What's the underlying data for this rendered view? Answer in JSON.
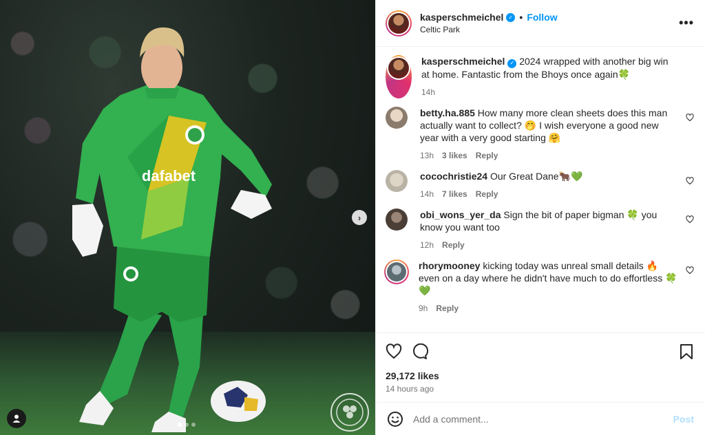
{
  "post": {
    "username": "kasperschmeichel",
    "location": "Celtic Park",
    "follow_label": "Follow",
    "sep": "•",
    "more": "•••"
  },
  "caption": {
    "username": "kasperschmeichel",
    "text": "2024 wrapped with another big win at home. Fantastic from the Bhoys once again🍀",
    "time": "14h"
  },
  "comments": [
    {
      "username": "betty.ha.885",
      "text": "How many more clean sheets does this man actually want to collect? 🤭 I wish everyone a good new year with a very good starting 🤗",
      "time": "13h",
      "likes": "3 likes",
      "reply": "Reply",
      "avatar_color": "#8a7b6d"
    },
    {
      "username": "cocochristie24",
      "text": "Our Great Dane🐂💚",
      "time": "14h",
      "likes": "7 likes",
      "reply": "Reply",
      "avatar_color": "#b9b3a6"
    },
    {
      "username": "obi_wons_yer_da",
      "text": "Sign the bit of paper bigman 🍀 you know you want too",
      "time": "12h",
      "likes": "",
      "reply": "Reply",
      "avatar_color": "#4a3e36"
    },
    {
      "username": "rhorymooney",
      "text": "kicking today was unreal small details 🔥 even on a day where he didn't have much to do effortless 🍀💚",
      "time": "9h",
      "likes": "",
      "reply": "Reply",
      "avatar_color": "#5d6b72"
    }
  ],
  "likes": "29,172 likes",
  "posted": "14 hours ago",
  "add_comment": {
    "placeholder": "Add a comment...",
    "post_label": "Post"
  },
  "media": {
    "slides": 3,
    "active_slide": 1
  },
  "colors": {
    "accent": "#0095f6",
    "kit_green": "#2fa14a",
    "kit_yellow": "#d7c323"
  }
}
